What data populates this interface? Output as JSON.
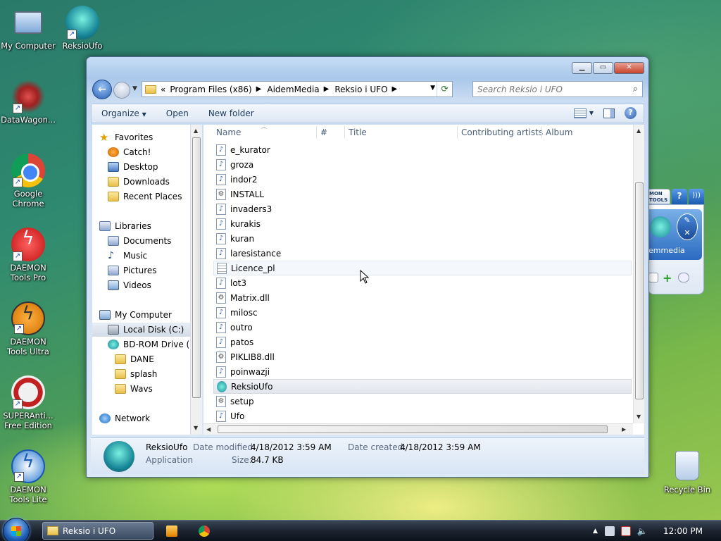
{
  "desktop": {
    "icons": [
      {
        "label": "My Computer"
      },
      {
        "label": "ReksioUfo"
      },
      {
        "label": "DataWagon..."
      },
      {
        "label": "Google Chrome"
      },
      {
        "label": "DAEMON Tools Pro"
      },
      {
        "label": "DAEMON Tools Ultra"
      },
      {
        "label": "SUPERAnti... Free Edition"
      },
      {
        "label": "DAEMON Tools Lite"
      },
      {
        "label": "Recycle Bin"
      }
    ]
  },
  "window": {
    "nav": {
      "breadcrumb_prefix": "«",
      "breadcrumbs": [
        "Program Files (x86)",
        "AidemMedia",
        "Reksio i UFO"
      ],
      "search_placeholder": "Search Reksio i UFO"
    },
    "toolbar": {
      "organize": "Organize",
      "open": "Open",
      "new_folder": "New folder"
    },
    "navpane": {
      "items": [
        {
          "label": "Favorites",
          "icon": "star-icon"
        },
        {
          "label": "Catch!",
          "icon": "catch-icon"
        },
        {
          "label": "Desktop",
          "icon": "desktop-icon"
        },
        {
          "label": "Downloads",
          "icon": "downloads-icon"
        },
        {
          "label": "Recent Places",
          "icon": "recent-places-icon"
        },
        {
          "label": "Libraries",
          "icon": "libraries-icon"
        },
        {
          "label": "Documents",
          "icon": "documents-icon"
        },
        {
          "label": "Music",
          "icon": "music-icon"
        },
        {
          "label": "Pictures",
          "icon": "pictures-icon"
        },
        {
          "label": "Videos",
          "icon": "videos-icon"
        },
        {
          "label": "My Computer",
          "icon": "computer-icon"
        },
        {
          "label": "Local Disk (C:)",
          "icon": "disk-icon"
        },
        {
          "label": "BD-ROM Drive (E",
          "icon": "bd-rom-icon"
        },
        {
          "label": "DANE",
          "icon": "folder-icon"
        },
        {
          "label": "splash",
          "icon": "folder-icon"
        },
        {
          "label": "Wavs",
          "icon": "folder-icon"
        },
        {
          "label": "Network",
          "icon": "network-icon"
        }
      ]
    },
    "columns": {
      "name": "Name",
      "number": "#",
      "title": "Title",
      "artists": "Contributing artists",
      "album": "Album"
    },
    "files": [
      {
        "name": "e_kurator",
        "type": "audio"
      },
      {
        "name": "groza",
        "type": "audio"
      },
      {
        "name": "indor2",
        "type": "audio"
      },
      {
        "name": "INSTALL",
        "type": "settings"
      },
      {
        "name": "invaders3",
        "type": "audio"
      },
      {
        "name": "kurakis",
        "type": "audio"
      },
      {
        "name": "kuran",
        "type": "audio"
      },
      {
        "name": "laresistance",
        "type": "audio"
      },
      {
        "name": "Licence_pl",
        "type": "text"
      },
      {
        "name": "lot3",
        "type": "audio"
      },
      {
        "name": "Matrix.dll",
        "type": "dll"
      },
      {
        "name": "milosc",
        "type": "audio"
      },
      {
        "name": "outro",
        "type": "audio"
      },
      {
        "name": "patos",
        "type": "audio"
      },
      {
        "name": "PIKLIB8.dll",
        "type": "dll"
      },
      {
        "name": "poinwazji",
        "type": "audio"
      },
      {
        "name": "ReksioUfo",
        "type": "app"
      },
      {
        "name": "setup",
        "type": "settings"
      },
      {
        "name": "Ufo",
        "type": "audio"
      }
    ],
    "details": {
      "name": "ReksioUfo",
      "type": "Application",
      "modified_label": "Date modified:",
      "modified_value": "4/18/2012 3:59 AM",
      "created_label": "Date created:",
      "created_value": "4/18/2012 3:59 AM",
      "size_label": "Size:",
      "size_value": "84.7 KB"
    }
  },
  "gadget": {
    "header": "MON TOOLS",
    "label": "emmedia"
  },
  "taskbar": {
    "active_window": "Reksio i UFO",
    "clock": "12:00 PM"
  }
}
